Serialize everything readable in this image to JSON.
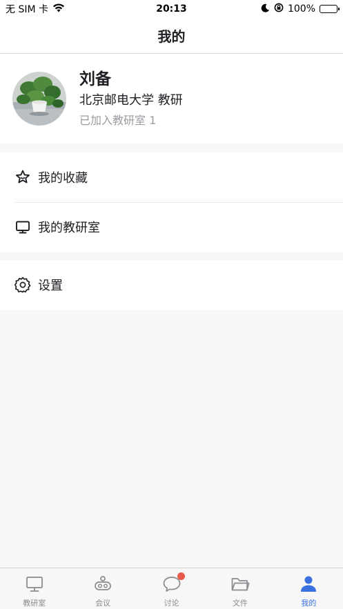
{
  "status_bar": {
    "carrier": "无 SIM 卡",
    "time": "20:13",
    "battery": "100%"
  },
  "nav": {
    "title": "我的"
  },
  "profile": {
    "name": "刘备",
    "organization": "北京邮电大学 教研",
    "joined": "已加入教研室 1"
  },
  "menu": {
    "favorites": {
      "label": "我的收藏",
      "icon": "star-icon"
    },
    "labs": {
      "label": "我的教研室",
      "icon": "monitor-icon"
    },
    "settings": {
      "label": "设置",
      "icon": "gear-icon"
    }
  },
  "tabs": [
    {
      "label": "教研室",
      "icon": "monitor-icon",
      "active": false
    },
    {
      "label": "会议",
      "icon": "meeting-icon",
      "active": false
    },
    {
      "label": "讨论",
      "icon": "chat-bubble-icon",
      "active": false,
      "badge": true
    },
    {
      "label": "文件",
      "icon": "folder-icon",
      "active": false
    },
    {
      "label": "我的",
      "icon": "person-icon",
      "active": true
    }
  ],
  "colors": {
    "accent": "#3a6fe0",
    "badge": "#e5584a",
    "background": "#f8f8f8",
    "text": "#1f1f24",
    "secondary_text": "#9a9aa0"
  }
}
